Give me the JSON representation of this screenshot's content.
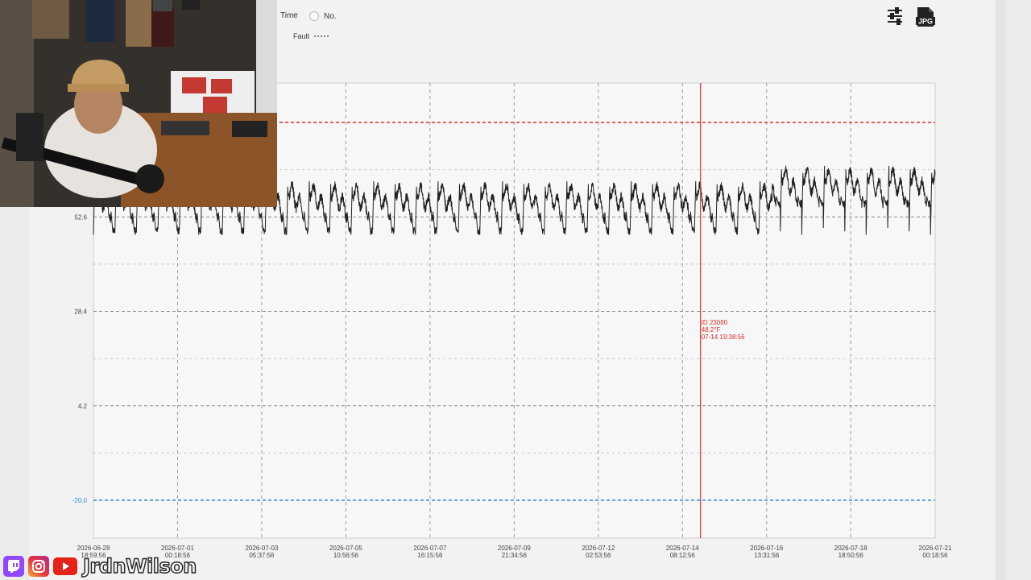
{
  "toolbar": {
    "options": [
      {
        "label": "Time",
        "selected": false
      },
      {
        "label": "No.",
        "selected": false
      }
    ],
    "legend": {
      "label": "Fault",
      "style": "dotted"
    },
    "settings_icon": "sliders-icon",
    "export_label": "JPG"
  },
  "chart_data": {
    "type": "line",
    "y_ticks": [
      "52.6",
      "28.4",
      "4.2",
      "-20.0"
    ],
    "x_ticks": [
      {
        "date": "2026-06-28",
        "time": "18:59:56"
      },
      {
        "date": "2026-07-01",
        "time": "00:18:56"
      },
      {
        "date": "2026-07-03",
        "time": "05:37:56"
      },
      {
        "date": "2026-07-05",
        "time": "10:56:56"
      },
      {
        "date": "2026-07-07",
        "time": "16:15:56"
      },
      {
        "date": "2026-07-09",
        "time": "21:34:56"
      },
      {
        "date": "2026-07-12",
        "time": "02:53:56"
      },
      {
        "date": "2026-07-14",
        "time": "08:12:56"
      },
      {
        "date": "2026-07-16",
        "time": "13:31:56"
      },
      {
        "date": "2026-07-18",
        "time": "18:50:56"
      },
      {
        "date": "2026-07-21",
        "time": "00:18:56"
      }
    ],
    "ylim": [
      -20.0,
      76.8
    ],
    "grid": true,
    "thresholds": [
      {
        "value": 76.8,
        "color": "#d9302c",
        "style": "dashed"
      },
      {
        "value": -20.0,
        "color": "#2a8fd4",
        "style": "dashed"
      }
    ],
    "series_color": "#222222",
    "cursor": {
      "time": "2026-07-14 19:38:56",
      "color": "#d9302c",
      "tooltip": [
        "ID 23080",
        "48.2°F",
        "07-14 19:38:56"
      ]
    }
  },
  "social": {
    "platforms": [
      "twitch-icon",
      "instagram-icon",
      "youtube-icon"
    ],
    "handle": "JrdnWilson"
  }
}
